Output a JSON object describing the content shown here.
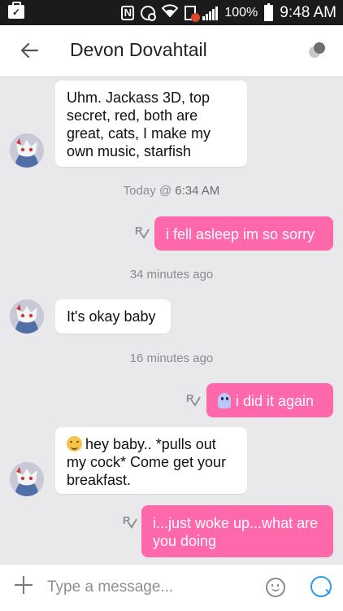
{
  "status_bar": {
    "battery_percent": "100%",
    "time": "9:48 AM",
    "nfc_label": "N"
  },
  "header": {
    "contact_name": "Devon Dovahtail",
    "back_icon": "arrow-left-icon",
    "status_icon": "presence-dots-icon"
  },
  "messages": [
    {
      "direction": "incoming",
      "text": "Uhm. Jackass 3D, top secret, red, both are great, cats, I make my own music, starfish"
    },
    {
      "direction": "timestamp",
      "prefix": "Today @ ",
      "time": "6:34 AM"
    },
    {
      "direction": "outgoing",
      "receipt": "R",
      "text": "i fell asleep im so sorry"
    },
    {
      "direction": "timestamp",
      "text": "34 minutes ago"
    },
    {
      "direction": "incoming",
      "text": "It's okay baby"
    },
    {
      "direction": "timestamp",
      "text": "16 minutes ago"
    },
    {
      "direction": "outgoing",
      "receipt": "R",
      "emoji": "ghost-emoji",
      "text": "i did it again"
    },
    {
      "direction": "incoming",
      "emoji": "blush-emoji",
      "text": "hey baby..  *pulls out my cock* Come get your breakfast."
    },
    {
      "direction": "outgoing",
      "receipt": "R",
      "text": "i...just woke up...what are you doing"
    }
  ],
  "composer": {
    "placeholder": "Type a message...",
    "plus_icon": "plus-icon",
    "emoji_icon": "smiley-icon",
    "send_icon": "send-icon"
  },
  "colors": {
    "outgoing_bubble": "#ff68ab",
    "incoming_bubble": "#ffffff",
    "background": "#e9e9ec"
  }
}
